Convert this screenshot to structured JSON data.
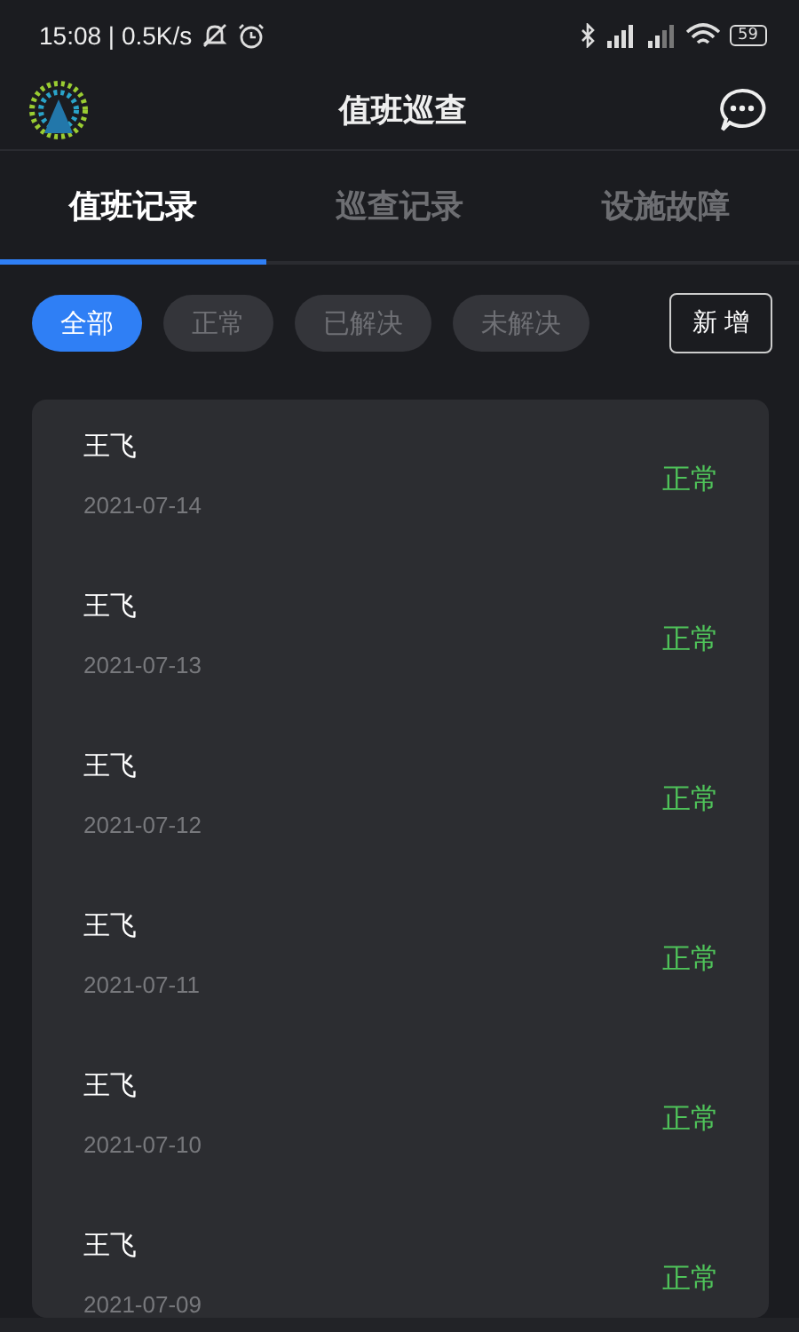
{
  "status_bar": {
    "time": "15:08 | 0.5K/s",
    "battery": "59"
  },
  "header": {
    "title": "值班巡查"
  },
  "tabs": [
    {
      "label": "值班记录",
      "selected": true
    },
    {
      "label": "巡查记录",
      "selected": false
    },
    {
      "label": "设施故障",
      "selected": false
    }
  ],
  "filters": [
    {
      "label": "全部",
      "selected": true
    },
    {
      "label": "正常",
      "selected": false
    },
    {
      "label": "已解决",
      "selected": false
    },
    {
      "label": "未解决",
      "selected": false
    }
  ],
  "add_button": "新增",
  "records": [
    {
      "name": "王飞",
      "date": "2021-07-14",
      "status": "正常",
      "kind": "normal"
    },
    {
      "name": "王飞",
      "date": "2021-07-13",
      "status": "正常",
      "kind": "normal"
    },
    {
      "name": "王飞",
      "date": "2021-07-12",
      "status": "正常",
      "kind": "normal"
    },
    {
      "name": "王飞",
      "date": "2021-07-11",
      "status": "正常",
      "kind": "normal"
    },
    {
      "name": "王飞",
      "date": "2021-07-10",
      "status": "正常",
      "kind": "normal"
    },
    {
      "name": "王飞",
      "date": "2021-07-09",
      "status": "正常",
      "kind": "normal"
    }
  ]
}
